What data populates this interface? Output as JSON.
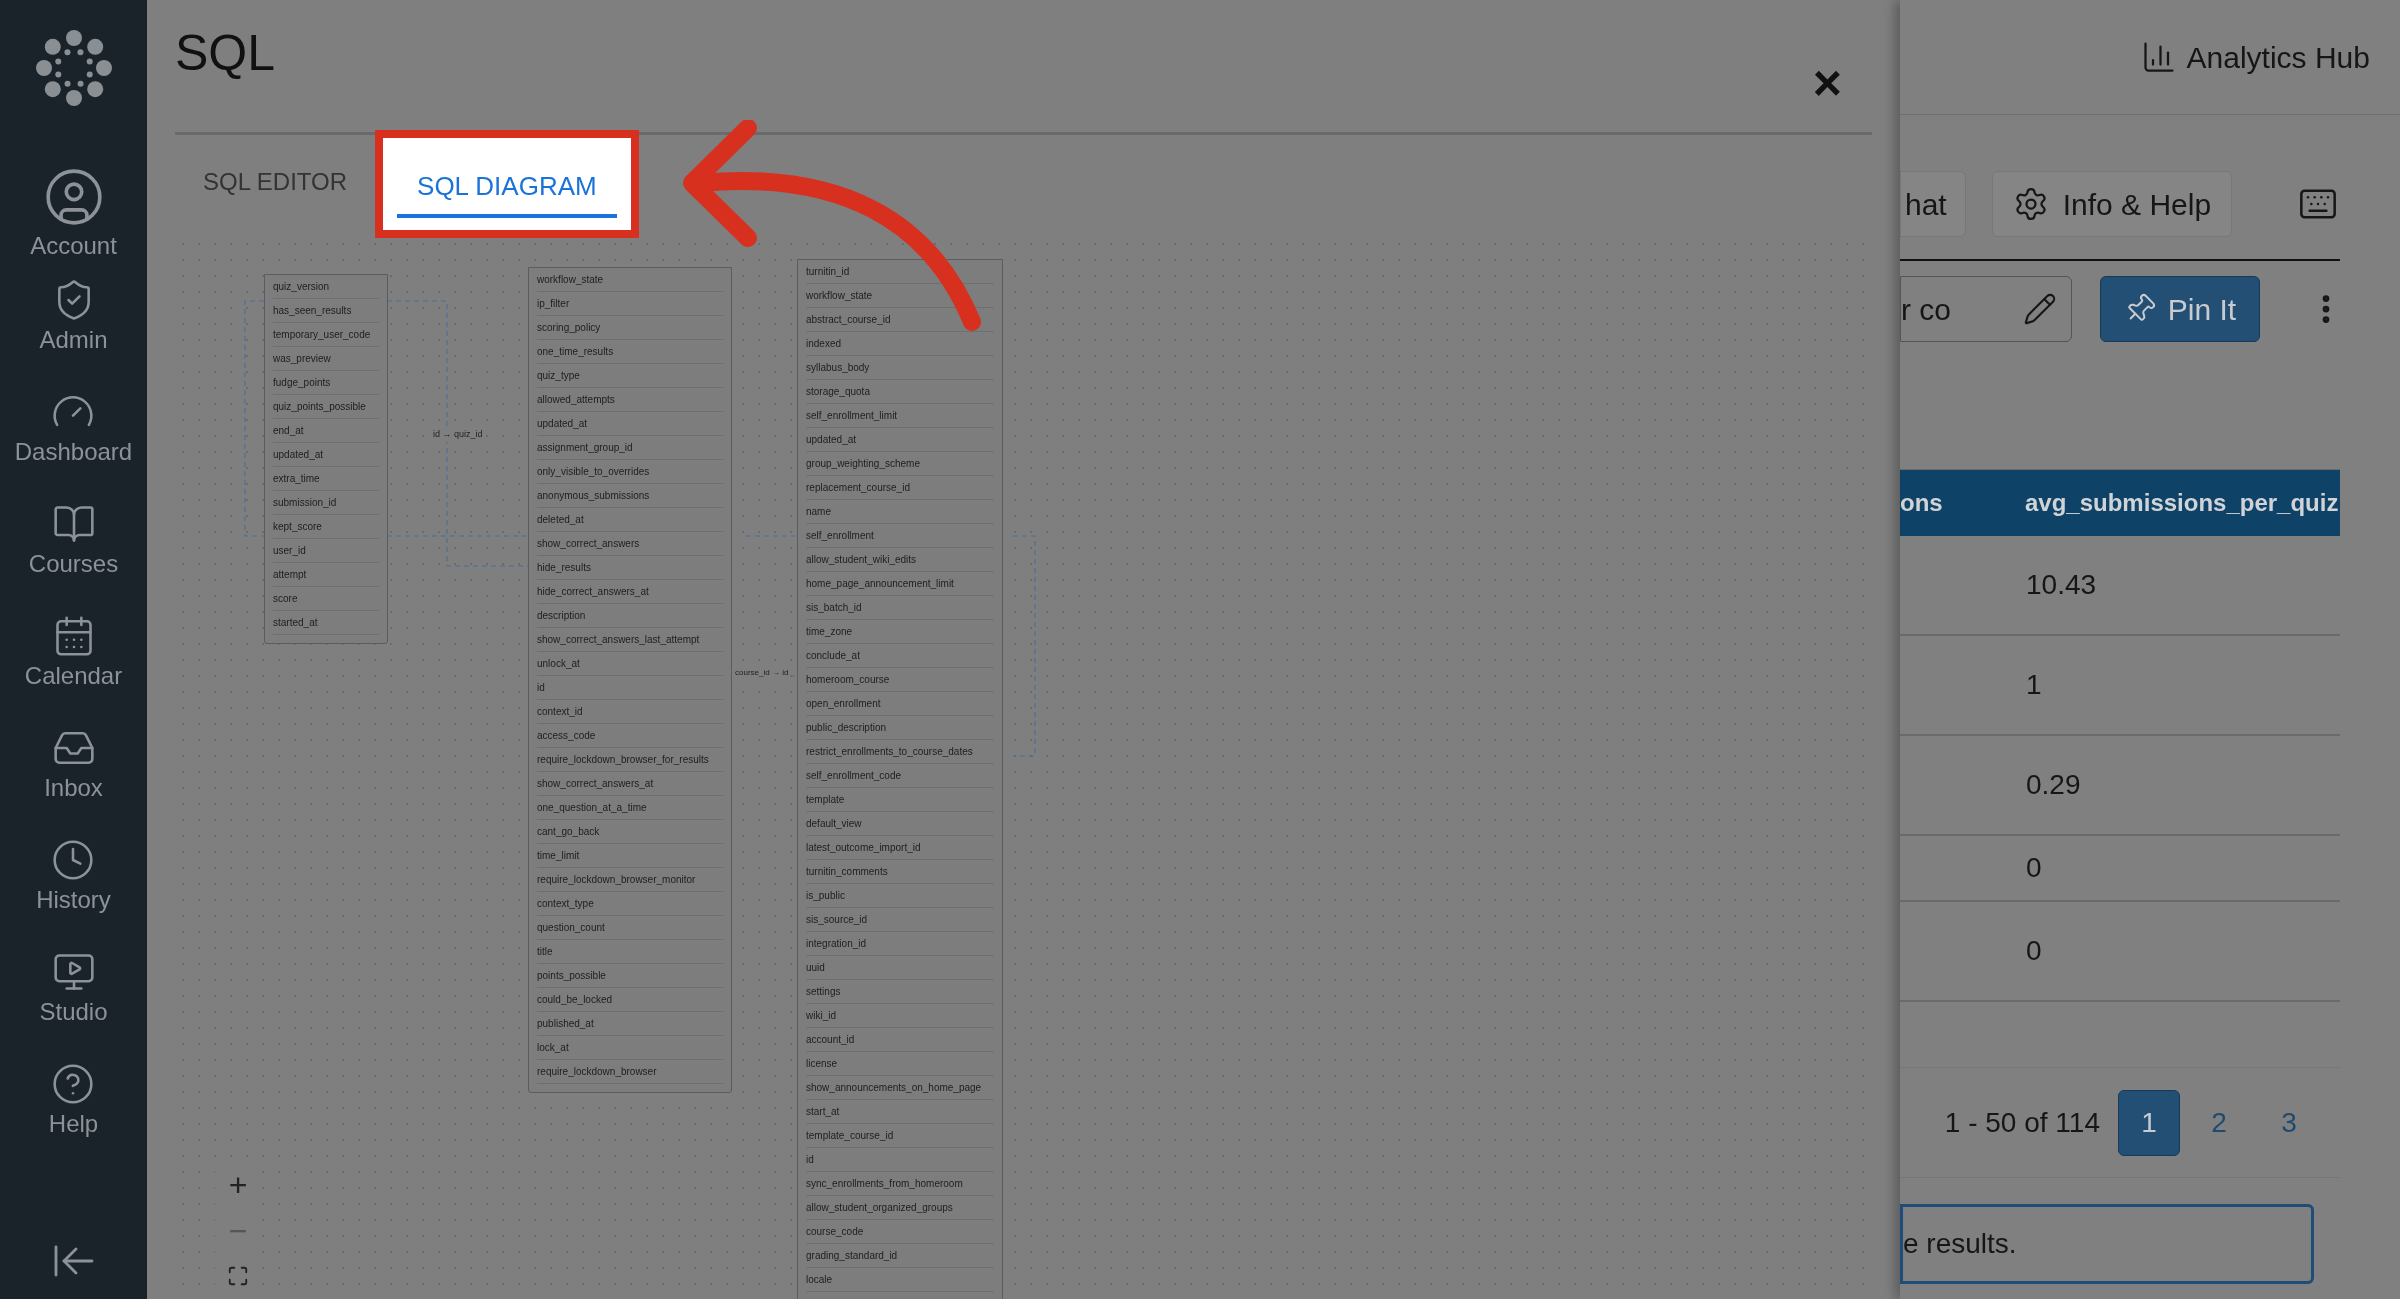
{
  "sidebar": {
    "items": [
      {
        "kind": "account",
        "label": "Account"
      },
      {
        "kind": "admin",
        "label": "Admin"
      },
      {
        "kind": "dashboard",
        "label": "Dashboard"
      },
      {
        "kind": "courses",
        "label": "Courses"
      },
      {
        "kind": "calendar",
        "label": "Calendar"
      },
      {
        "kind": "inbox",
        "label": "Inbox"
      },
      {
        "kind": "history",
        "label": "History"
      },
      {
        "kind": "studio",
        "label": "Studio"
      },
      {
        "kind": "help",
        "label": "Help"
      }
    ]
  },
  "modal": {
    "title": "SQL",
    "close": "×",
    "tabs": [
      {
        "label": "SQL EDITOR",
        "selected": false
      },
      {
        "label": "SQL DIAGRAM",
        "selected": true
      }
    ],
    "diagram": {
      "tables": [
        {
          "columns": [
            "quiz_version",
            "has_seen_results",
            "temporary_user_code",
            "was_preview",
            "fudge_points",
            "quiz_points_possible",
            "end_at",
            "updated_at",
            "extra_time",
            "submission_id",
            "kept_score",
            "user_id",
            "attempt",
            "score",
            "started_at"
          ]
        },
        {
          "columns": [
            "workflow_state",
            "ip_filter",
            "scoring_policy",
            "one_time_results",
            "quiz_type",
            "allowed_attempts",
            "updated_at",
            "assignment_group_id",
            "only_visible_to_overrides",
            "anonymous_submissions",
            "deleted_at",
            "show_correct_answers",
            "hide_results",
            "hide_correct_answers_at",
            "description",
            "show_correct_answers_last_attempt",
            "unlock_at",
            "id",
            "context_id",
            "access_code",
            "require_lockdown_browser_for_results",
            "show_correct_answers_at",
            "one_question_at_a_time",
            "cant_go_back",
            "time_limit",
            "require_lockdown_browser_monitor",
            "context_type",
            "question_count",
            "title",
            "points_possible",
            "could_be_locked",
            "published_at",
            "lock_at",
            "require_lockdown_browser"
          ]
        },
        {
          "columns": [
            "turnitin_id",
            "workflow_state",
            "abstract_course_id",
            "indexed",
            "syllabus_body",
            "storage_quota",
            "self_enrollment_limit",
            "updated_at",
            "group_weighting_scheme",
            "replacement_course_id",
            "name",
            "self_enrollment",
            "allow_student_wiki_edits",
            "home_page_announcement_limit",
            "sis_batch_id",
            "time_zone",
            "conclude_at",
            "homeroom_course",
            "open_enrollment",
            "public_description",
            "restrict_enrollments_to_course_dates",
            "self_enrollment_code",
            "template",
            "default_view",
            "latest_outcome_import_id",
            "turnitin_comments",
            "is_public",
            "sis_source_id",
            "integration_id",
            "uuid",
            "settings",
            "wiki_id",
            "account_id",
            "license",
            "show_announcements_on_home_page",
            "start_at",
            "template_course_id",
            "id",
            "sync_enrollments_from_homeroom",
            "allow_student_organized_groups",
            "course_code",
            "grading_standard_id",
            "locale"
          ]
        }
      ],
      "relations": [
        "id → quiz_id",
        "course_id → id"
      ],
      "zoom_controls": [
        "+",
        "−"
      ]
    }
  },
  "background": {
    "header": "Analytics Hub",
    "buttons": [
      "hat",
      "Info & Help"
    ],
    "query_field": "r co",
    "pin_button": "Pin It",
    "table": {
      "columns": [
        "ons",
        "avg_submissions_per_quiz"
      ],
      "rows": [
        "10.43",
        "1",
        "0.29",
        "0",
        "0"
      ]
    },
    "pagination": {
      "range": "1 - 50 of 114",
      "pages": [
        {
          "label": "1",
          "selected": true
        },
        {
          "label": "2",
          "selected": false
        },
        {
          "label": "3",
          "selected": false
        }
      ]
    },
    "message": "e results."
  }
}
